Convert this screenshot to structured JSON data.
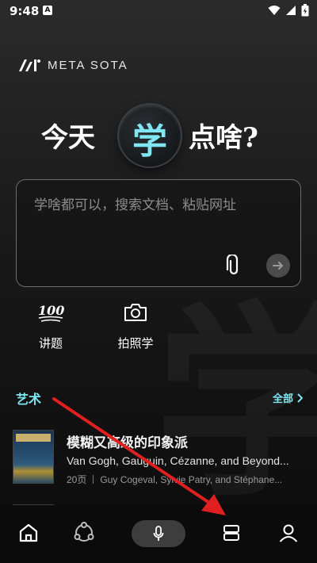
{
  "status_bar": {
    "time": "9:48",
    "badge": "A"
  },
  "logo": {
    "brand": "META SOTA"
  },
  "headline": {
    "left": "今天",
    "center": "学",
    "right": "点啥?"
  },
  "input": {
    "placeholder": "学啥都可以，搜索文档、粘贴网址"
  },
  "quick_actions": [
    {
      "label": "讲题",
      "icon": "hundred-points-icon"
    },
    {
      "label": "拍照学",
      "icon": "camera-icon"
    }
  ],
  "section": {
    "title": "艺术",
    "more_label": "全部"
  },
  "books": [
    {
      "title": "模糊又高级的印象派",
      "subtitle": "Van Gogh, Gauguin, Cézanne, and Beyond...",
      "pages": "20页",
      "authors": "Guy Cogeval, Sylvie Patry, and Stéphane..."
    }
  ],
  "watermark": "学",
  "colors": {
    "accent": "#7fe6f2",
    "annotation": "#e02020"
  }
}
